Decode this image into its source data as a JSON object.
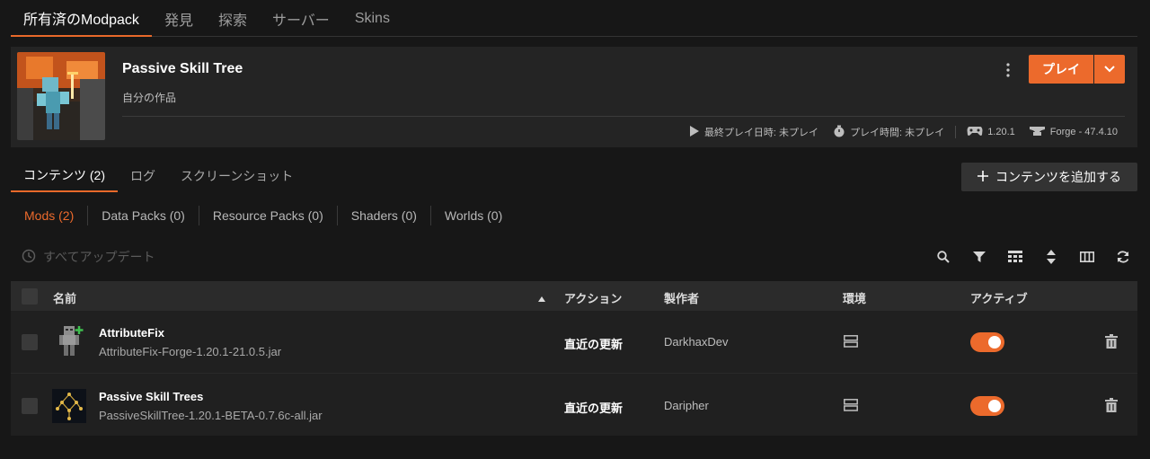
{
  "topnav": {
    "tabs": [
      "所有済のModpack",
      "発見",
      "探索",
      "サーバー",
      "Skins"
    ]
  },
  "modpack": {
    "title": "Passive Skill Tree",
    "subtitle": "自分の作品",
    "play_label": "プレイ",
    "meta": {
      "last_played": "最終プレイ日時: 未プレイ",
      "play_time": "プレイ時間: 未プレイ",
      "version": "1.20.1",
      "loader": "Forge - 47.4.10"
    }
  },
  "content_tabs": [
    "コンテンツ (2)",
    "ログ",
    "スクリーンショット"
  ],
  "add_content_label": "コンテンツを追加する",
  "filters": [
    "Mods (2)",
    "Data Packs (0)",
    "Resource Packs (0)",
    "Shaders (0)",
    "Worlds (0)"
  ],
  "update_all_label": "すべてアップデート",
  "table": {
    "headers": {
      "name": "名前",
      "action": "アクション",
      "author": "製作者",
      "env": "環境",
      "active": "アクティブ"
    },
    "rows": [
      {
        "name": "AttributeFix",
        "file": "AttributeFix-Forge-1.20.1-21.0.5.jar",
        "action": "直近の更新",
        "author": "DarkhaxDev",
        "active": true
      },
      {
        "name": "Passive Skill Trees",
        "file": "PassiveSkillTree-1.20.1-BETA-0.7.6c-all.jar",
        "action": "直近の更新",
        "author": "Daripher",
        "active": true
      }
    ]
  },
  "colors": {
    "accent": "#ec6a2c",
    "background": "#171717",
    "card": "#242424"
  },
  "icons": {
    "kebab": "more-vertical-icon",
    "play_dropdown": "chevron-down-icon",
    "last_played": "play-icon",
    "play_time": "stopwatch-icon",
    "version": "gamepad-icon",
    "loader": "anvil-icon",
    "add": "plus-icon",
    "update_all": "history-icon",
    "tools": [
      "search-icon",
      "filter-icon",
      "grid-icon",
      "sort-icon",
      "columns-icon",
      "refresh-icon"
    ],
    "env": "server-icon",
    "delete": "trash-icon"
  }
}
